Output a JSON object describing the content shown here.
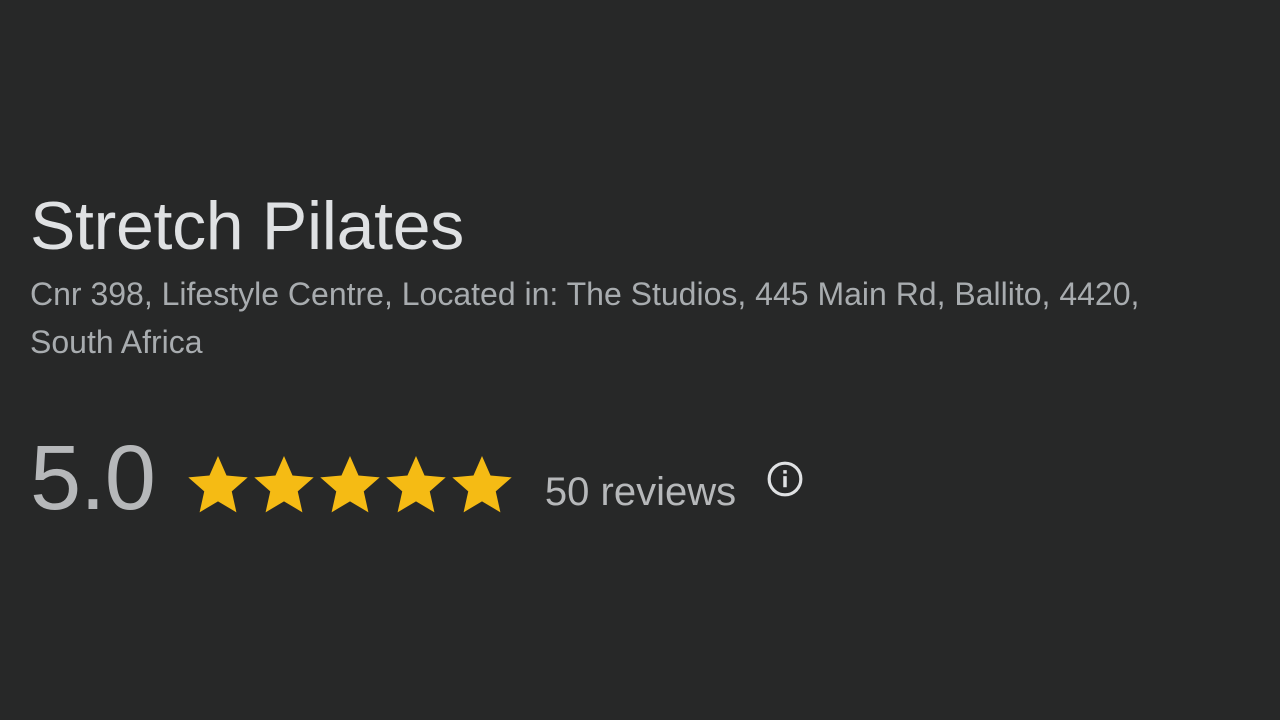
{
  "place": {
    "name": "Stretch Pilates",
    "address": "Cnr 398, Lifestyle Centre, Located in: The Studios, 445 Main Rd, Ballito, 4420, South Africa"
  },
  "rating": {
    "value": "5.0",
    "stars": 5,
    "max_stars": 5,
    "reviews_label": "50 reviews",
    "star_color": "#f5bb14"
  },
  "icons": {
    "star": "star-icon",
    "info": "info-icon"
  },
  "colors": {
    "background": "#272828",
    "title": "#dfe1e3",
    "secondary_text": "#a8acaf"
  }
}
